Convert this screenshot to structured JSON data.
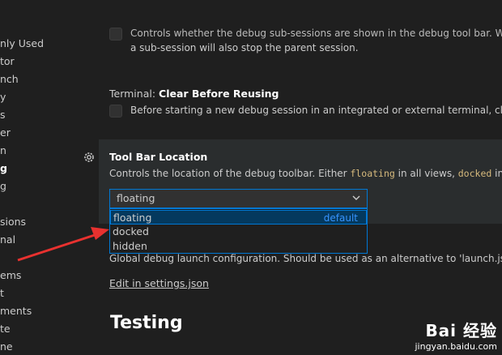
{
  "sidebar": {
    "items": [
      {
        "label": "nly Used"
      },
      {
        "label": "tor"
      },
      {
        "label": "nch"
      },
      {
        "label": "y"
      },
      {
        "label": "s"
      },
      {
        "label": "er"
      },
      {
        "label": "n"
      },
      {
        "label": "g"
      },
      {
        "label": "g"
      },
      {
        "label": "sions"
      },
      {
        "label": "nal"
      },
      {
        "label": "ems"
      },
      {
        "label": "t"
      },
      {
        "label": "ments"
      },
      {
        "label": "te"
      },
      {
        "label": "ne"
      }
    ]
  },
  "settings": {
    "subsession": {
      "line1": "Controls whether the debug sub-sessions are shown in the debug tool bar. When",
      "line2": "a sub-session will also stop the parent session."
    },
    "terminal": {
      "category": "Terminal: ",
      "name": "Clear Before Reusing",
      "description": "Before starting a new debug session in an integrated or external terminal, clear t"
    },
    "toolbar_location": {
      "name": "Tool Bar Location",
      "desc_part1": "Controls the location of the debug toolbar. Either ",
      "code1": "floating",
      "desc_part2": " in all views, ",
      "code2": "docked",
      "desc_part3": " in th",
      "selected_value": "floating",
      "options": [
        {
          "label": "floating",
          "badge": "default"
        },
        {
          "label": "docked",
          "badge": ""
        },
        {
          "label": "hidden",
          "badge": ""
        }
      ]
    },
    "launch": {
      "description": "Global debug launch configuration. Should be used as an alternative to 'launch.json' t",
      "edit_link": "Edit in settings.json"
    },
    "next_section": "Testing"
  },
  "watermark": {
    "brand": "Bai 经验",
    "url": "jingyan.baidu.com"
  },
  "colors": {
    "accent": "#0078d4",
    "annotation_arrow": "#e8312f",
    "code": "#d7ba7d",
    "link_default": "#3794ff"
  }
}
